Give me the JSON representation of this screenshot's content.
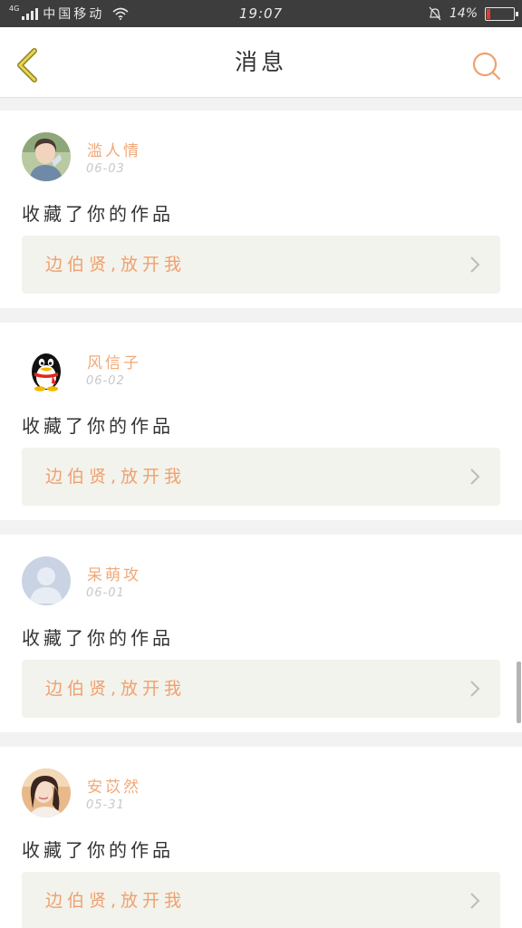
{
  "status_bar": {
    "network": "4G",
    "carrier": "中国移动",
    "time": "19:07",
    "battery": "14%",
    "battery_level": 0.14,
    "battery_color": "#e53935"
  },
  "nav": {
    "title": "消息",
    "back_icon": "chevron-left-icon",
    "search_icon": "search-icon"
  },
  "accent_color": "#f0a070",
  "messages": [
    {
      "username": "滥人情",
      "date": "06-03",
      "action": "收藏了你的作品",
      "work_title": "边伯贤,放开我",
      "avatar": "photo"
    },
    {
      "username": "风信子",
      "date": "06-02",
      "action": "收藏了你的作品",
      "work_title": "边伯贤,放开我",
      "avatar": "penguin"
    },
    {
      "username": "呆萌攻",
      "date": "06-01",
      "action": "收藏了你的作品",
      "work_title": "边伯贤,放开我",
      "avatar": "default-user"
    },
    {
      "username": "安苡然",
      "date": "05-31",
      "action": "收藏了你的作品",
      "work_title": "边伯贤,放开我",
      "avatar": "photo"
    }
  ]
}
